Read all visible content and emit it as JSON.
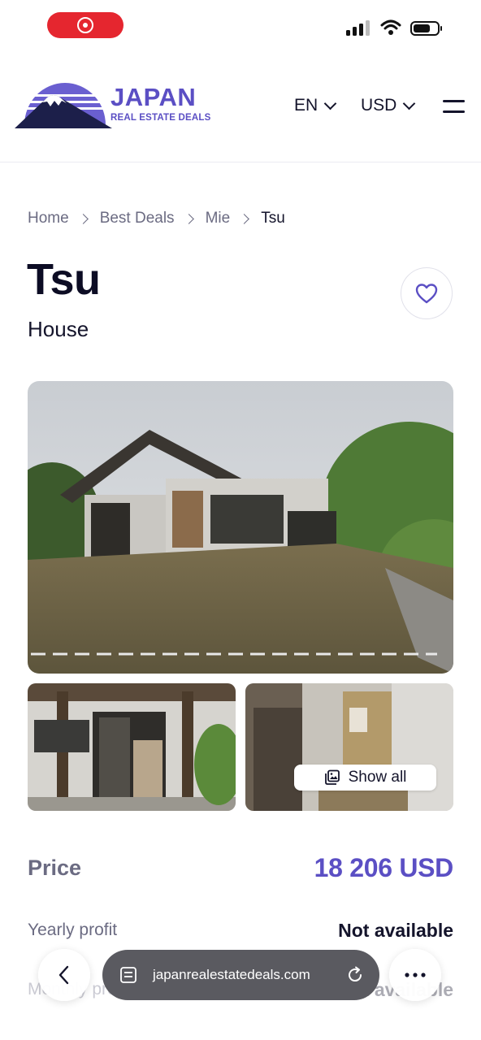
{
  "header": {
    "logo_word": "JAPAN",
    "logo_sub": "REAL ESTATE DEALS",
    "language": "EN",
    "currency": "USD"
  },
  "breadcrumb": [
    "Home",
    "Best Deals",
    "Mie",
    "Tsu"
  ],
  "listing": {
    "title": "Tsu",
    "type": "House",
    "show_all_label": "Show all",
    "price_label": "Price",
    "price_value": "18 206 USD",
    "yearly_profit_label": "Yearly profit",
    "yearly_profit_value": "Not available",
    "monthly_profit_label": "Monthly profit",
    "monthly_profit_value": "Not available"
  },
  "browser": {
    "url": "japanrealestatedeals.com"
  },
  "colors": {
    "accent": "#5b4fc4",
    "record_pill": "#e5262f",
    "url_bar": "#5a5a60"
  },
  "icons": [
    "record-icon",
    "signal-icon",
    "wifi-icon",
    "battery-icon",
    "chevron-down-icon",
    "hamburger-menu-icon",
    "chevron-right-icon",
    "heart-icon",
    "gallery-icon",
    "back-arrow-icon",
    "tabs-icon",
    "reload-icon",
    "more-icon"
  ]
}
